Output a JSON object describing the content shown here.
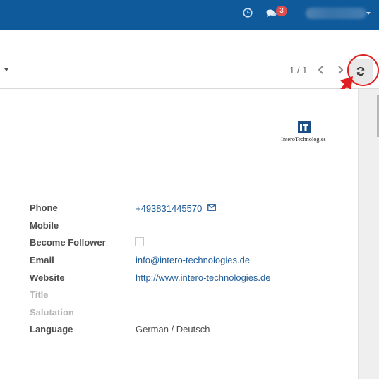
{
  "navbar": {
    "notification_count": "3",
    "icons": {
      "activity": "clock-icon",
      "messages": "chat-icon",
      "user_menu": "caret-down-icon"
    },
    "color": "#0f5a9b"
  },
  "pager": {
    "value": "1 / 1"
  },
  "company": {
    "logo_text": "InteroTechnologies",
    "logo_mark": "IT"
  },
  "fields": {
    "phone": {
      "label": "Phone",
      "value": "+493831445570"
    },
    "mobile": {
      "label": "Mobile",
      "value": ""
    },
    "become_follower": {
      "label": "Become Follower",
      "checked": false
    },
    "email": {
      "label": "Email",
      "value": "info@intero-technologies.de"
    },
    "website": {
      "label": "Website",
      "value": "http://www.intero-technologies.de"
    },
    "title": {
      "label": "Title",
      "value": ""
    },
    "salutation": {
      "label": "Salutation",
      "value": ""
    },
    "language": {
      "label": "Language",
      "value": "German / Deutsch"
    }
  },
  "colors": {
    "link": "#1f5c9a",
    "annotation": "#e02020",
    "badge": "#e04d4d"
  }
}
